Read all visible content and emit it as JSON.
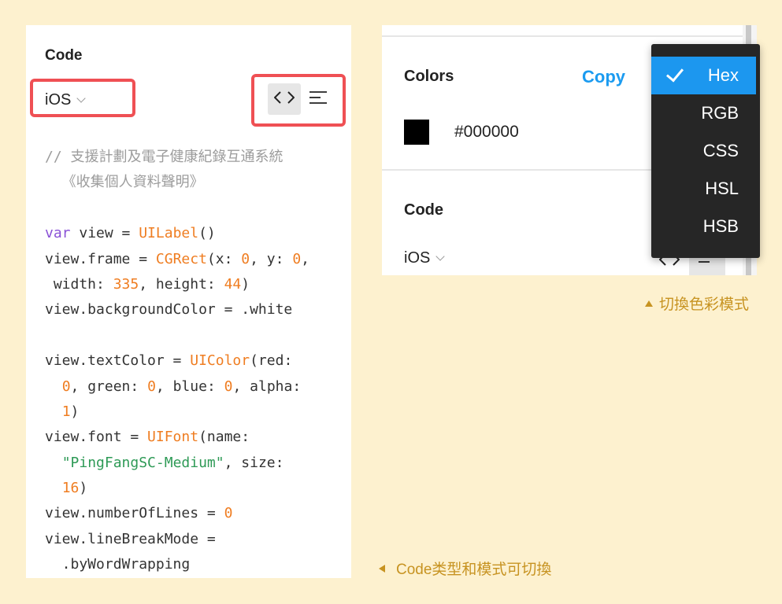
{
  "code_panel": {
    "title": "Code",
    "language": "iOS",
    "icons": [
      "code-view-icon",
      "text-align-icon"
    ]
  },
  "code_lines": [
    [
      {
        "t": "// 支援計劃及電子健康紀錄互通系統",
        "c": "comment"
      }
    ],
    [
      {
        "t": "  《收集個人資料聲明》",
        "c": "comment"
      }
    ],
    [],
    [
      {
        "t": "var",
        "c": "t-kw"
      },
      {
        "t": " view = "
      },
      {
        "t": "UILabel",
        "c": "t-fn"
      },
      {
        "t": "()"
      }
    ],
    [
      {
        "t": "view.frame = "
      },
      {
        "t": "CGRect",
        "c": "t-fn"
      },
      {
        "t": "(x: "
      },
      {
        "t": "0",
        "c": "t-num"
      },
      {
        "t": ", y: "
      },
      {
        "t": "0",
        "c": "t-num"
      },
      {
        "t": ","
      }
    ],
    [
      {
        "t": " width: "
      },
      {
        "t": "335",
        "c": "t-num"
      },
      {
        "t": ", height: "
      },
      {
        "t": "44",
        "c": "t-num"
      },
      {
        "t": ")"
      }
    ],
    [
      {
        "t": "view.backgroundColor = .white"
      }
    ],
    [],
    [
      {
        "t": "view.textColor = "
      },
      {
        "t": "UIColor",
        "c": "t-fn"
      },
      {
        "t": "(red:"
      }
    ],
    [
      {
        "t": "  "
      },
      {
        "t": "0",
        "c": "t-num"
      },
      {
        "t": ", green: "
      },
      {
        "t": "0",
        "c": "t-num"
      },
      {
        "t": ", blue: "
      },
      {
        "t": "0",
        "c": "t-num"
      },
      {
        "t": ", alpha:"
      }
    ],
    [
      {
        "t": "  "
      },
      {
        "t": "1",
        "c": "t-num"
      },
      {
        "t": ")"
      }
    ],
    [
      {
        "t": "view.font = "
      },
      {
        "t": "UIFont",
        "c": "t-fn"
      },
      {
        "t": "(name:"
      }
    ],
    [
      {
        "t": "  "
      },
      {
        "t": "\"PingFangSC-Medium\"",
        "c": "t-str"
      },
      {
        "t": ", size:"
      }
    ],
    [
      {
        "t": "  "
      },
      {
        "t": "16",
        "c": "t-num"
      },
      {
        "t": ")"
      }
    ],
    [
      {
        "t": "view.numberOfLines = "
      },
      {
        "t": "0",
        "c": "t-num"
      }
    ],
    [
      {
        "t": "view.lineBreakMode ="
      }
    ],
    [
      {
        "t": "  .byWordWrapping"
      }
    ]
  ],
  "colors_panel": {
    "title": "Colors",
    "copy_label": "Copy",
    "swatch_color": "#000000",
    "hex_value": "#000000",
    "code_title": "Code",
    "language": "iOS"
  },
  "color_mode_menu": {
    "items": [
      "Hex",
      "RGB",
      "CSS",
      "HSL",
      "HSB"
    ],
    "selected": "Hex"
  },
  "captions": {
    "color_mode": "切換色彩模式",
    "code_mode": "Code类型和模式可切換"
  },
  "theme": {
    "background": "#fdf1cf",
    "highlight_red": "#ef5054",
    "accent_blue": "#1c97ef",
    "caption_gold": "#c79321"
  }
}
